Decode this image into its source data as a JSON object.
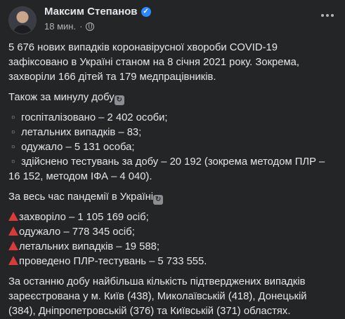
{
  "post": {
    "author": "Максим Степанов",
    "time": "18 мин.",
    "intro": "5 676 нових випадків коронавірусної хвороби COVID-19 зафіксовано в Україні станом на 8 січня 2021 року. Зокрема, захворіли 166 дітей та 179 медпрацівників.",
    "last_day_title": "Також за минулу добу",
    "last_day": [
      "госпіталізовано – 2 402 особи;",
      "летальних випадків – 83;",
      "одужало – 5 131 особа;",
      "здійснено тестувань за добу – 20 192 (зокрема методом ПЛР –",
      "16 152, методом ІФА – 4 040)."
    ],
    "pandemic_title": "За весь час пандемії в Україні",
    "pandemic": [
      "захворіло – 1 105 169 осіб;",
      "одужало – 778 345 осіб;",
      "летальних випадків – 19 588;",
      "проведено ПЛР-тестувань – 5 733 555."
    ],
    "outro": "За останню добу найбільша кількість підтверджених випадків зареєстрована у м. Київ (438), Миколаївській (418), Донецькій (384), Дніпропетровській (376) та Київській (371) областях."
  },
  "colors": {
    "background": "#242526",
    "text": "#e4e6eb",
    "secondary": "#b0b3b8",
    "verified": "#2d88ff",
    "triangle": "#d93a3a"
  }
}
